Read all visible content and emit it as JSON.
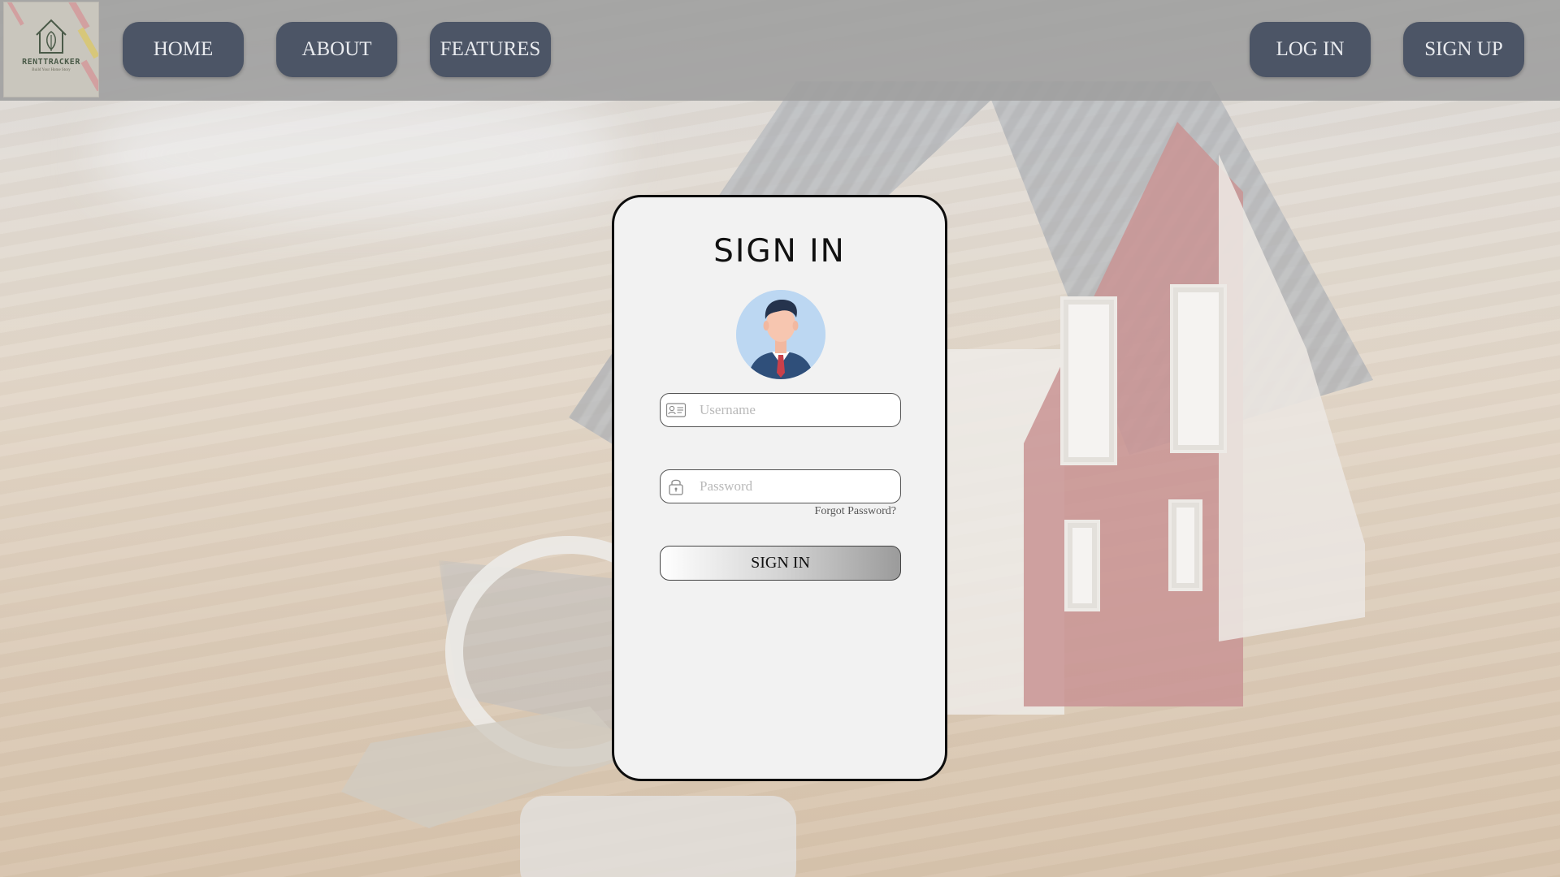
{
  "logo": {
    "text": "RENTTRACKER",
    "subtext": "Build Your Home Story"
  },
  "nav": {
    "home": "HOME",
    "about": "ABOUT",
    "features": "FEATURES",
    "login": "LOG IN",
    "signup": "SIGN UP"
  },
  "signin": {
    "title": "SIGN IN",
    "username_placeholder": "Username",
    "password_placeholder": "Password",
    "forgot": "Forgot Password?",
    "button": "SIGN IN"
  },
  "colors": {
    "navbar_bg": "#9e9e9e",
    "nav_button": "#4c5566",
    "card_bg": "#f2f2f2",
    "accent_red": "#b56b6b"
  },
  "icons": {
    "username": "id-card-icon",
    "password": "lock-icon",
    "avatar": "businessman-avatar"
  }
}
